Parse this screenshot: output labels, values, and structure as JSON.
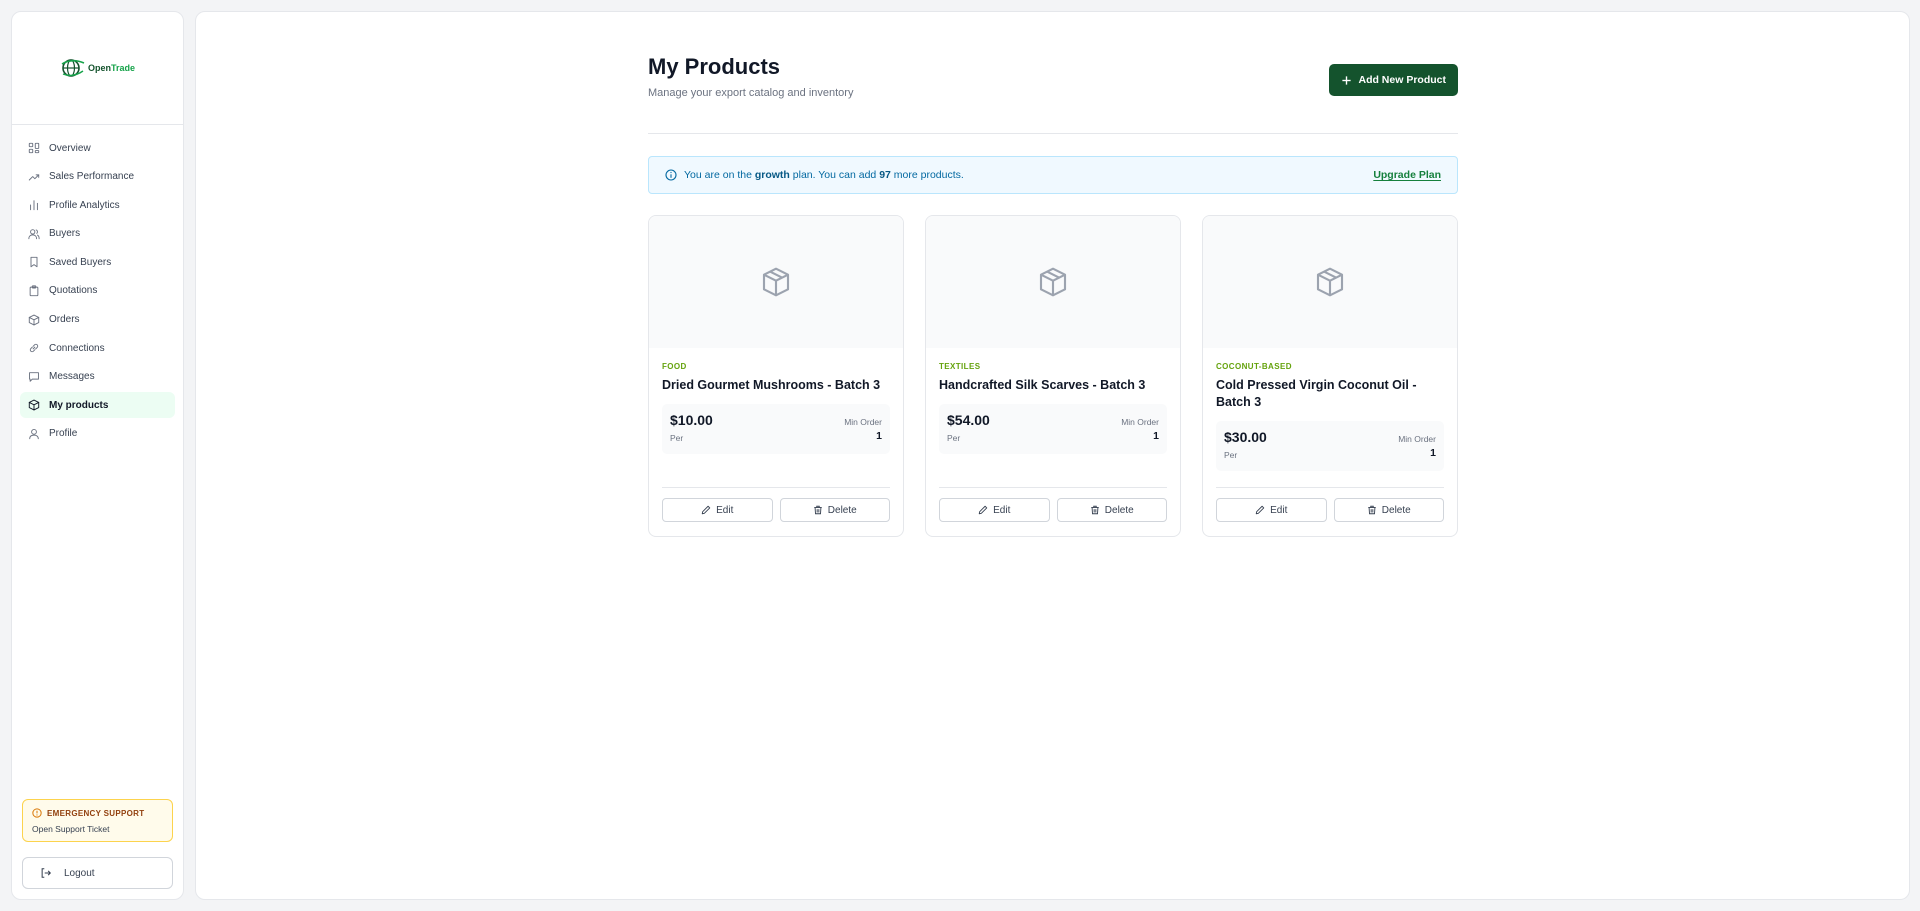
{
  "brand": {
    "name_part1": "Open",
    "name_part2": "Trade"
  },
  "sidebar": {
    "items": [
      {
        "label": "Overview",
        "icon": "grid-icon"
      },
      {
        "label": "Sales Performance",
        "icon": "trending-up-icon"
      },
      {
        "label": "Profile Analytics",
        "icon": "bar-chart-icon"
      },
      {
        "label": "Buyers",
        "icon": "users-icon"
      },
      {
        "label": "Saved Buyers",
        "icon": "bookmark-icon"
      },
      {
        "label": "Quotations",
        "icon": "clipboard-icon"
      },
      {
        "label": "Orders",
        "icon": "package-icon"
      },
      {
        "label": "Connections",
        "icon": "link-icon"
      },
      {
        "label": "Messages",
        "icon": "message-icon"
      },
      {
        "label": "My products",
        "icon": "package-icon",
        "active": true
      },
      {
        "label": "Profile",
        "icon": "user-icon"
      }
    ],
    "support": {
      "title": "EMERGENCY SUPPORT",
      "link": "Open Support Ticket"
    },
    "logout": "Logout"
  },
  "header": {
    "title": "My Products",
    "subtitle": "Manage your export catalog and inventory",
    "add_button": "Add New Product"
  },
  "plan_banner": {
    "prefix": "You are on the",
    "plan": "growth",
    "middle": "plan. You can add",
    "count": "97",
    "suffix": "more products.",
    "upgrade": "Upgrade Plan"
  },
  "products": [
    {
      "category": "FOOD",
      "name": "Dried Gourmet Mushrooms - Batch 3",
      "price": "$10.00",
      "per": "Per",
      "min_order_label": "Min Order",
      "min_order": "1",
      "edit": "Edit",
      "delete": "Delete"
    },
    {
      "category": "TEXTILES",
      "name": "Handcrafted Silk Scarves - Batch 3",
      "price": "$54.00",
      "per": "Per",
      "min_order_label": "Min Order",
      "min_order": "1",
      "edit": "Edit",
      "delete": "Delete"
    },
    {
      "category": "COCONUT-BASED",
      "name": "Cold Pressed Virgin Coconut Oil - Batch 3",
      "price": "$30.00",
      "per": "Per",
      "min_order_label": "Min Order",
      "min_order": "1",
      "edit": "Edit",
      "delete": "Delete"
    }
  ],
  "colors": {
    "accent": "#14532d",
    "active_bg": "#ecfdf3",
    "category": "#65a30d",
    "banner_bg": "#f0f9ff"
  }
}
